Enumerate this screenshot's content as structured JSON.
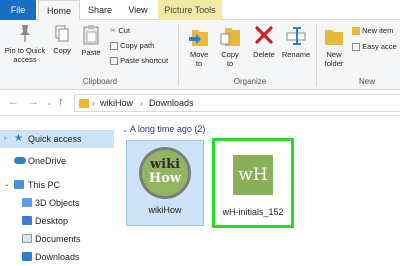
{
  "tabs": [
    "File",
    "Home",
    "Share",
    "View",
    "Picture Tools"
  ],
  "ribbon": {
    "pin": "Pin to Quick access",
    "copy": "Copy",
    "paste": "Paste",
    "cut": "Cut",
    "copy_path": "Copy path",
    "paste_shortcut": "Paste shortcut",
    "clipboard": "Clipboard",
    "move_to": "Move to",
    "copy_to": "Copy to",
    "delete": "Delete",
    "rename": "Rename",
    "organize": "Organize",
    "new_folder": "New folder",
    "new_item": "New item",
    "easy_access": "Easy acce",
    "new": "New"
  },
  "breadcrumb": [
    "wikiHow",
    "Downloads"
  ],
  "nav_pane": [
    "Quick access",
    "OneDrive",
    "This PC",
    "3D Objects",
    "Desktop",
    "Documents",
    "Downloads"
  ],
  "content": {
    "group_title": "A long time ago (2)",
    "files": [
      {
        "name": "wikiHow",
        "logo_line1": "wiki",
        "logo_line2": "How"
      },
      {
        "name": "wH-initials_152",
        "logo": "wH"
      }
    ]
  }
}
